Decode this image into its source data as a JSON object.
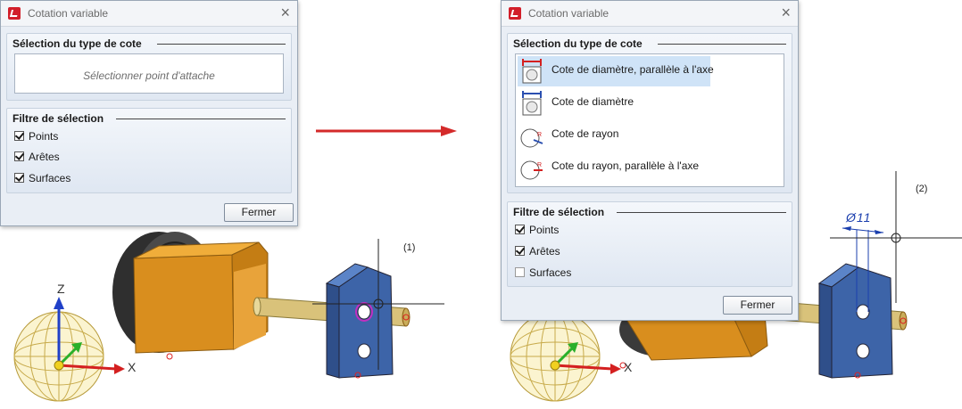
{
  "left_dialog": {
    "title": "Cotation variable",
    "section_type": "Sélection du type de cote",
    "placeholder": "Sélectionner point d'attache",
    "section_filter": "Filtre de sélection",
    "filters": [
      {
        "label": "Points",
        "checked": true
      },
      {
        "label": "Arêtes",
        "checked": true
      },
      {
        "label": "Surfaces",
        "checked": true
      }
    ],
    "close_label": "Fermer"
  },
  "right_dialog": {
    "title": "Cotation variable",
    "section_type": "Sélection du type de cote",
    "dimension_types": [
      {
        "label": "Cote de diamètre, parallèle à l'axe",
        "icon": "diameter-parallel-icon",
        "selected": true
      },
      {
        "label": "Cote de diamètre",
        "icon": "diameter-icon",
        "selected": false
      },
      {
        "label": "Cote de rayon",
        "icon": "radius-icon",
        "selected": false
      },
      {
        "label": "Cote du rayon, parallèle à l'axe",
        "icon": "radius-parallel-icon",
        "selected": false
      }
    ],
    "section_filter": "Filtre de sélection",
    "filters": [
      {
        "label": "Points",
        "checked": true
      },
      {
        "label": "Arêtes",
        "checked": true
      },
      {
        "label": "Surfaces",
        "checked": false
      }
    ],
    "close_label": "Fermer"
  },
  "viewport": {
    "callout_1": "(1)",
    "callout_2": "(2)",
    "axis_x": "X",
    "axis_y": "Y",
    "axis_z": "Z",
    "dimension_value": "Ø11"
  },
  "colors": {
    "arrow": "#d42a2a",
    "bracket": "#3d64a8",
    "housing": "#e39b2a",
    "wheel": "#3a3a3a",
    "shaft": "#d9c27a",
    "dimension": "#1b3fae"
  }
}
